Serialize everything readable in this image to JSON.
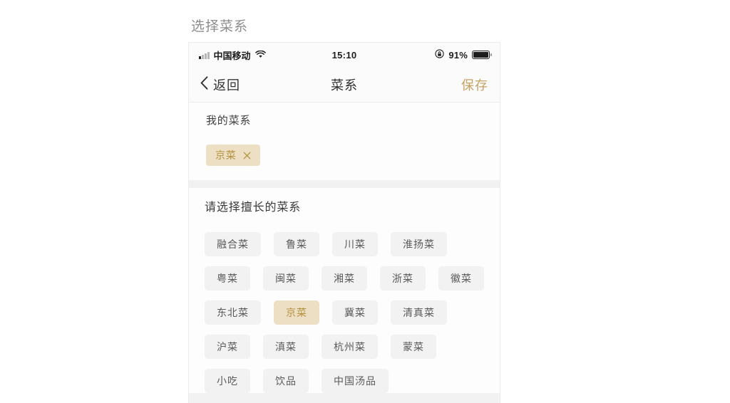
{
  "page": {
    "caption": "选择菜系"
  },
  "statusbar": {
    "signal_icon": "signal-bars-icon",
    "carrier": "中国移动",
    "wifi_icon": "wifi-icon",
    "time": "15:10",
    "rotation_lock_icon": "rotation-lock-icon",
    "battery_percent": "91%",
    "battery_icon": "battery-full-icon"
  },
  "navbar": {
    "back_icon": "chevron-left-icon",
    "back_label": "返回",
    "title": "菜系",
    "save_label": "保存"
  },
  "my_cuisines": {
    "section_title": "我的菜系",
    "chips": [
      {
        "label": "京菜",
        "remove_icon": "close-icon"
      }
    ]
  },
  "choose_cuisines": {
    "section_title": "请选择擅长的菜系",
    "options": [
      {
        "label": "融合菜",
        "selected": false
      },
      {
        "label": "鲁菜",
        "selected": false
      },
      {
        "label": "川菜",
        "selected": false
      },
      {
        "label": "淮扬菜",
        "selected": false
      },
      {
        "label": "粤菜",
        "selected": false
      },
      {
        "label": "闽菜",
        "selected": false
      },
      {
        "label": "湘菜",
        "selected": false
      },
      {
        "label": "浙菜",
        "selected": false
      },
      {
        "label": "徽菜",
        "selected": false
      },
      {
        "label": "东北菜",
        "selected": false
      },
      {
        "label": "京菜",
        "selected": true
      },
      {
        "label": "冀菜",
        "selected": false
      },
      {
        "label": "清真菜",
        "selected": false
      },
      {
        "label": "沪菜",
        "selected": false
      },
      {
        "label": "滇菜",
        "selected": false
      },
      {
        "label": "杭州菜",
        "selected": false
      },
      {
        "label": "蒙菜",
        "selected": false
      },
      {
        "label": "小吃",
        "selected": false
      },
      {
        "label": "饮品",
        "selected": false
      },
      {
        "label": "中国汤品",
        "selected": false
      }
    ]
  },
  "colors": {
    "accent_gold": "#c6a264",
    "chip_bg": "#ecdfc3",
    "chip_text": "#b4913f",
    "option_bg": "#f2f2f2",
    "option_text": "#5a5a5a",
    "page_bg": "#ffffff",
    "panel_bg": "#fdfdfd",
    "band_bg": "#f1f1f1"
  }
}
